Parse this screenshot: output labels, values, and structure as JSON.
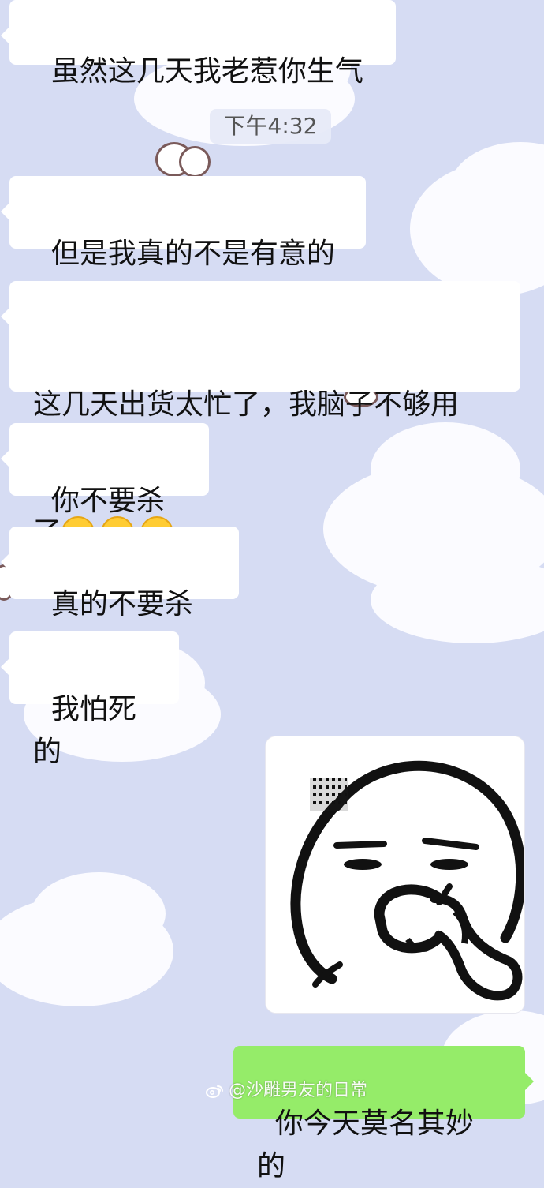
{
  "chat": {
    "timestamp": "下午4:32",
    "messages": [
      {
        "side": "left",
        "text": "虽然这几天我老惹你生气"
      },
      {
        "side": "left",
        "text": "但是我真的不是有意的"
      },
      {
        "side": "left",
        "text_line1": "这几天出货太忙了，我脑子不够用",
        "text_line2": "了",
        "emoji_name": "loudly-crying-face-icon",
        "emoji_count": 3
      },
      {
        "side": "left",
        "text": "你不要杀我"
      },
      {
        "side": "left",
        "text": "真的不要杀我"
      },
      {
        "side": "left",
        "text": "我怕死的"
      },
      {
        "side": "right",
        "type": "sticker",
        "sticker_name": "meme-face-picking-nose-sticker"
      },
      {
        "side": "right",
        "text": "你今天莫名其妙的"
      }
    ]
  },
  "watermark": {
    "text": "@沙雕男友的日常",
    "icon_name": "weibo-icon"
  },
  "colors": {
    "background": "#d6dcf3",
    "incoming_bubble": "#ffffff",
    "outgoing_bubble": "#95ec69",
    "timestamp_bg": "#e7eaf8"
  }
}
